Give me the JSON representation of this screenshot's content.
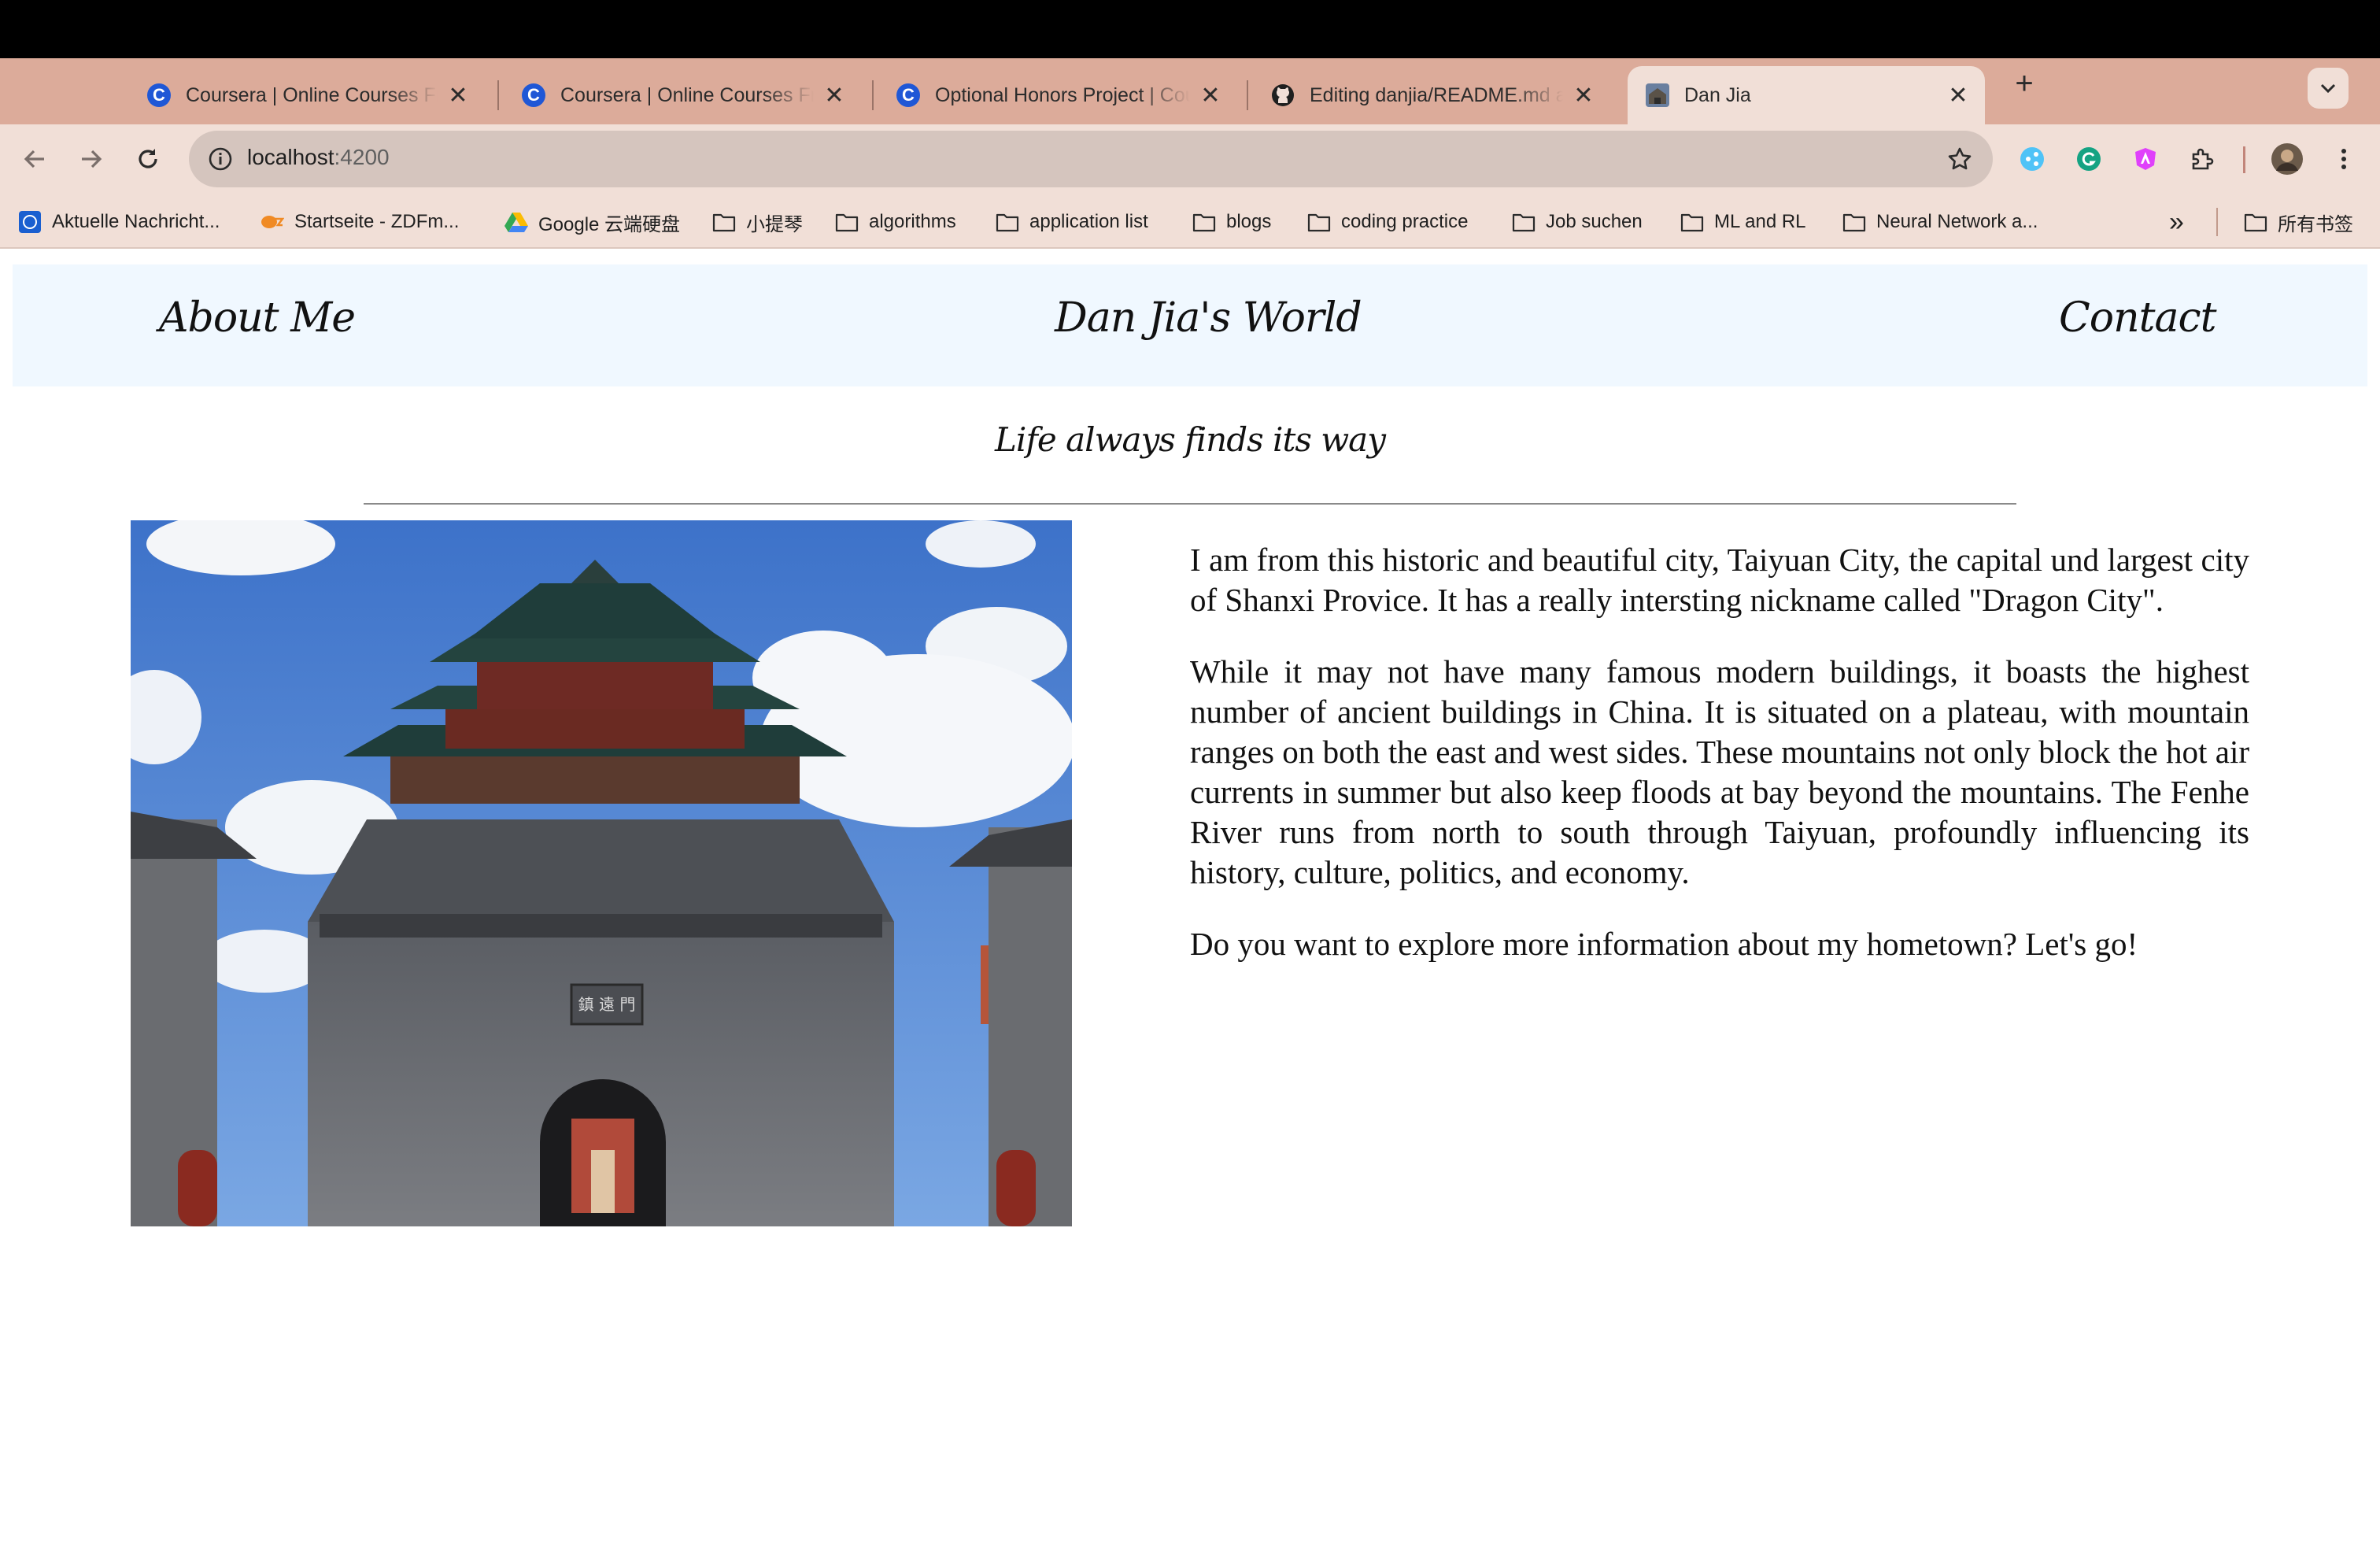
{
  "browser": {
    "tabs": [
      {
        "title": "Coursera | Online Courses From Top Universities",
        "favicon": "coursera-icon",
        "active": false
      },
      {
        "title": "Coursera | Online Courses From Top Universities",
        "favicon": "coursera-icon",
        "active": false
      },
      {
        "title": "Optional Honors Project | Coursera",
        "favicon": "coursera-icon",
        "active": false
      },
      {
        "title": "Editing danjia/README.md at main",
        "favicon": "github-icon",
        "active": false
      },
      {
        "title": "Dan Jia",
        "favicon": "site-photo-icon",
        "active": true
      }
    ],
    "close_glyph": "✕",
    "new_tab_glyph": "+",
    "address": {
      "host": "localhost",
      "port": ":4200"
    },
    "bookmarks": [
      {
        "label": "Aktuelle Nachricht...",
        "icon": "news-icon"
      },
      {
        "label": "Startseite - ZDFm...",
        "icon": "zdf-icon"
      },
      {
        "label": "Google 云端硬盘",
        "icon": "google-drive-icon"
      },
      {
        "label": "小提琴",
        "icon": "folder-icon"
      },
      {
        "label": "algorithms",
        "icon": "folder-icon"
      },
      {
        "label": "application list",
        "icon": "folder-icon"
      },
      {
        "label": "blogs",
        "icon": "folder-icon"
      },
      {
        "label": "coding practice",
        "icon": "folder-icon"
      },
      {
        "label": "Job suchen",
        "icon": "folder-icon"
      },
      {
        "label": "ML and RL",
        "icon": "folder-icon"
      },
      {
        "label": "Neural Network a...",
        "icon": "folder-icon"
      }
    ],
    "overflow_glyph": "»",
    "all_bookmarks_label": "所有书签"
  },
  "site": {
    "nav": {
      "about": "About Me",
      "brand": "Dan Jia's World",
      "contact": "Contact"
    },
    "tagline": "Life always finds its way",
    "paragraphs": [
      "I am from this historic and beautiful city, Taiyuan City, the capital und largest city of Shanxi Provice. It has a really intersting nickname called \"Dragon City\".",
      "While it may not have many famous modern buildings, it boasts the highest number of ancient buildings in China. It is situated on a plateau, with mountain ranges on both the east and west sides. These mountains not only block the hot air currents in summer but also keep floods at bay beyond the mountains. The Fenhe River runs from north to south through Taiyuan, profoundly influencing its history, culture, politics, and economy.",
      "Do you want to explore more information about my hometown? Let's go!"
    ],
    "photo_sign": "鎮 遠 門"
  }
}
